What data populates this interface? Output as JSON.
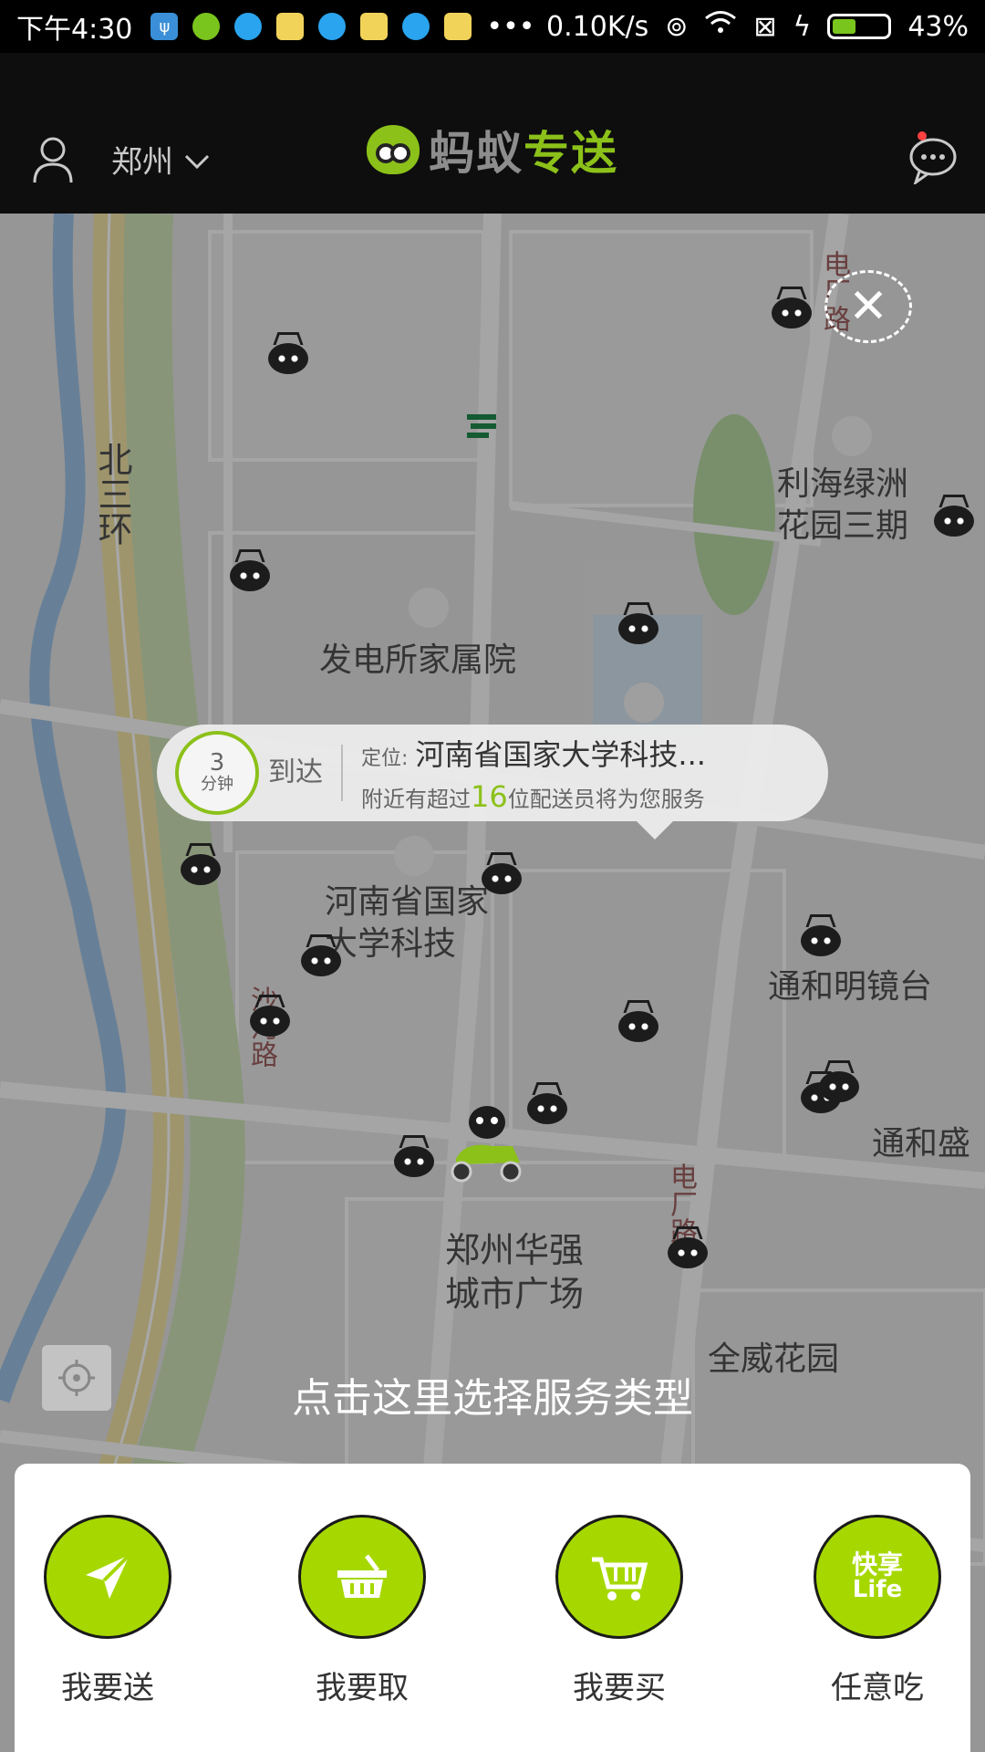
{
  "status_bar": {
    "time": "下午4:30",
    "net_speed": "0.10K/s",
    "battery": "43%",
    "battery_fraction": 0.43
  },
  "header": {
    "city": "郑州",
    "logo_text_a": "蚂蚁",
    "logo_text_b": "专送",
    "icons": [
      "user-icon",
      "chevron-down-icon",
      "chat-icon"
    ]
  },
  "map": {
    "labels": {
      "north_ring": "北三环",
      "power_plant": "发电所家属院",
      "lihai": "利海绿洲花园三期",
      "henan_univ": "河南省国家大学科技",
      "tonghe_mingjing": "通和明镜台",
      "tonghe_sheng": "通和盛",
      "huaqiang": "郑州华强城市广场",
      "quanwei": "全威花园",
      "dianchang_road_top": "电厂路",
      "dianchang_road": "电厂路",
      "honghe_road": "沙河路"
    }
  },
  "bubble": {
    "eta_number": "3",
    "eta_unit": "分钟",
    "arrive": "到达",
    "location_label": "定位:",
    "location": "河南省国家大学科技...",
    "nearby_prefix": "附近有超过",
    "nearby_count": "16",
    "nearby_suffix": "位配送员将为您服务"
  },
  "hint": "点击这里选择服务类型",
  "services": [
    {
      "label": "我要送",
      "icon": "paper-plane-icon"
    },
    {
      "label": "我要取",
      "icon": "basket-icon"
    },
    {
      "label": "我要买",
      "icon": "cart-icon"
    },
    {
      "label": "任意吃",
      "icon": "kuaixiang-life-icon",
      "icon_text_cn": "快享",
      "icon_text_en": "Life"
    }
  ],
  "colors": {
    "accent_green": "#a6d800",
    "logo_green": "#8cc11a"
  }
}
